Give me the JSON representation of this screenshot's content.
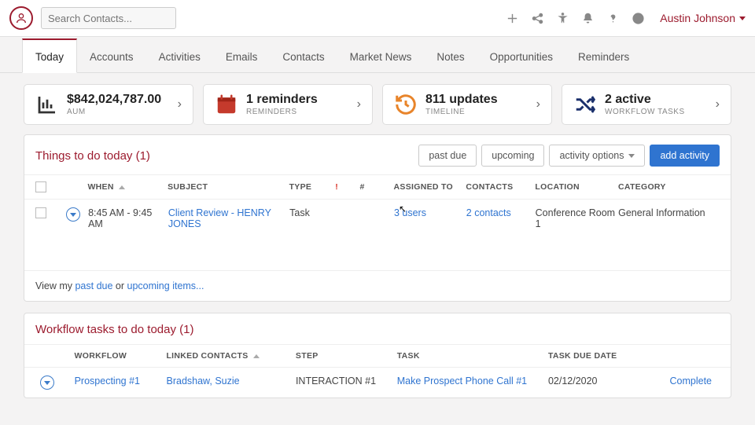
{
  "header": {
    "search_placeholder": "Search Contacts...",
    "username": "Austin Johnson"
  },
  "tabs": [
    "Today",
    "Accounts",
    "Activities",
    "Emails",
    "Contacts",
    "Market News",
    "Notes",
    "Opportunities",
    "Reminders"
  ],
  "active_tab": 0,
  "cards": [
    {
      "title": "$842,024,787.00",
      "sub": "AUM"
    },
    {
      "title": "1 reminders",
      "sub": "REMINDERS"
    },
    {
      "title": "811 updates",
      "sub": "TIMELINE"
    },
    {
      "title": "2 active",
      "sub": "WORKFLOW TASKS"
    }
  ],
  "things": {
    "title": "Things to do today (1)",
    "buttons": {
      "past_due": "past due",
      "upcoming": "upcoming",
      "options": "activity options",
      "add": "add activity"
    },
    "columns": {
      "when": "WHEN",
      "subject": "SUBJECT",
      "type": "TYPE",
      "priority": "!",
      "num": "#",
      "assigned": "ASSIGNED TO",
      "contacts": "CONTACTS",
      "location": "LOCATION",
      "category": "CATEGORY"
    },
    "row": {
      "when": "8:45 AM - 9:45 AM",
      "subject": "Client Review - HENRY JONES",
      "type": "Task",
      "assigned": "3 users",
      "contacts": "2 contacts",
      "location": "Conference Room 1",
      "category": "General Information"
    },
    "footer": {
      "prefix": "View my ",
      "link1": "past due",
      "mid": " or ",
      "link2": "upcoming items..."
    }
  },
  "workflow": {
    "title": "Workflow tasks to do today (1)",
    "columns": {
      "workflow": "WORKFLOW",
      "linked": "LINKED CONTACTS",
      "step": "STEP",
      "task": "TASK",
      "due": "TASK DUE DATE"
    },
    "row": {
      "workflow": "Prospecting #1",
      "linked": "Bradshaw, Suzie",
      "step": "INTERACTION #1",
      "task": "Make Prospect Phone Call #1",
      "due": "02/12/2020",
      "action": "Complete"
    }
  }
}
